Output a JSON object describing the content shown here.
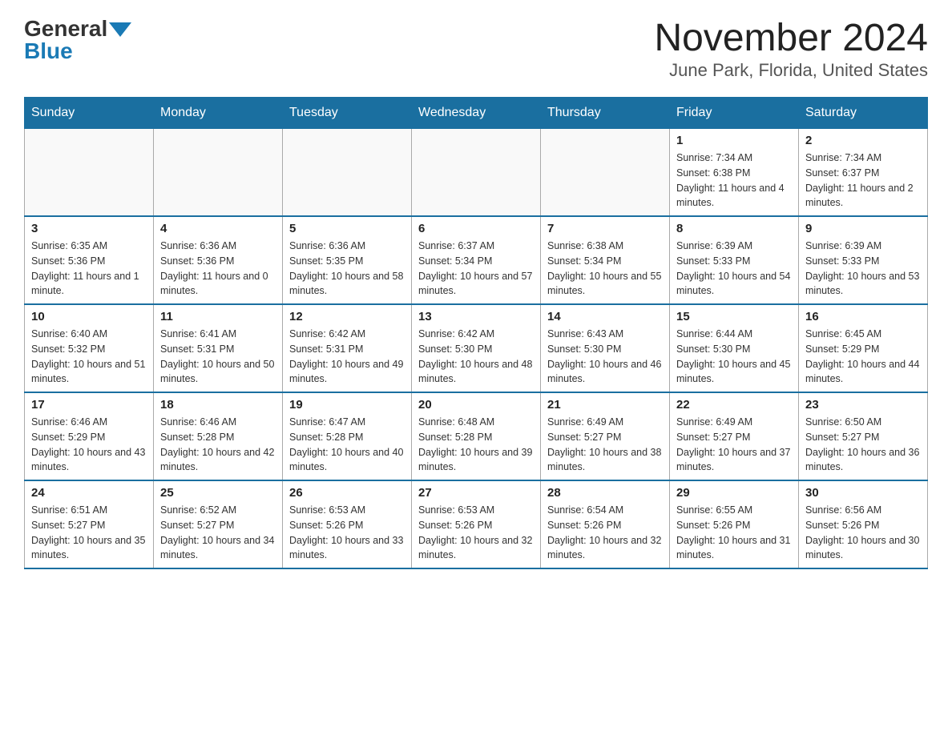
{
  "logo": {
    "general": "General",
    "blue": "Blue"
  },
  "title": "November 2024",
  "subtitle": "June Park, Florida, United States",
  "headers": [
    "Sunday",
    "Monday",
    "Tuesday",
    "Wednesday",
    "Thursday",
    "Friday",
    "Saturday"
  ],
  "weeks": [
    [
      {
        "day": "",
        "info": ""
      },
      {
        "day": "",
        "info": ""
      },
      {
        "day": "",
        "info": ""
      },
      {
        "day": "",
        "info": ""
      },
      {
        "day": "",
        "info": ""
      },
      {
        "day": "1",
        "info": "Sunrise: 7:34 AM\nSunset: 6:38 PM\nDaylight: 11 hours and 4 minutes."
      },
      {
        "day": "2",
        "info": "Sunrise: 7:34 AM\nSunset: 6:37 PM\nDaylight: 11 hours and 2 minutes."
      }
    ],
    [
      {
        "day": "3",
        "info": "Sunrise: 6:35 AM\nSunset: 5:36 PM\nDaylight: 11 hours and 1 minute."
      },
      {
        "day": "4",
        "info": "Sunrise: 6:36 AM\nSunset: 5:36 PM\nDaylight: 11 hours and 0 minutes."
      },
      {
        "day": "5",
        "info": "Sunrise: 6:36 AM\nSunset: 5:35 PM\nDaylight: 10 hours and 58 minutes."
      },
      {
        "day": "6",
        "info": "Sunrise: 6:37 AM\nSunset: 5:34 PM\nDaylight: 10 hours and 57 minutes."
      },
      {
        "day": "7",
        "info": "Sunrise: 6:38 AM\nSunset: 5:34 PM\nDaylight: 10 hours and 55 minutes."
      },
      {
        "day": "8",
        "info": "Sunrise: 6:39 AM\nSunset: 5:33 PM\nDaylight: 10 hours and 54 minutes."
      },
      {
        "day": "9",
        "info": "Sunrise: 6:39 AM\nSunset: 5:33 PM\nDaylight: 10 hours and 53 minutes."
      }
    ],
    [
      {
        "day": "10",
        "info": "Sunrise: 6:40 AM\nSunset: 5:32 PM\nDaylight: 10 hours and 51 minutes."
      },
      {
        "day": "11",
        "info": "Sunrise: 6:41 AM\nSunset: 5:31 PM\nDaylight: 10 hours and 50 minutes."
      },
      {
        "day": "12",
        "info": "Sunrise: 6:42 AM\nSunset: 5:31 PM\nDaylight: 10 hours and 49 minutes."
      },
      {
        "day": "13",
        "info": "Sunrise: 6:42 AM\nSunset: 5:30 PM\nDaylight: 10 hours and 48 minutes."
      },
      {
        "day": "14",
        "info": "Sunrise: 6:43 AM\nSunset: 5:30 PM\nDaylight: 10 hours and 46 minutes."
      },
      {
        "day": "15",
        "info": "Sunrise: 6:44 AM\nSunset: 5:30 PM\nDaylight: 10 hours and 45 minutes."
      },
      {
        "day": "16",
        "info": "Sunrise: 6:45 AM\nSunset: 5:29 PM\nDaylight: 10 hours and 44 minutes."
      }
    ],
    [
      {
        "day": "17",
        "info": "Sunrise: 6:46 AM\nSunset: 5:29 PM\nDaylight: 10 hours and 43 minutes."
      },
      {
        "day": "18",
        "info": "Sunrise: 6:46 AM\nSunset: 5:28 PM\nDaylight: 10 hours and 42 minutes."
      },
      {
        "day": "19",
        "info": "Sunrise: 6:47 AM\nSunset: 5:28 PM\nDaylight: 10 hours and 40 minutes."
      },
      {
        "day": "20",
        "info": "Sunrise: 6:48 AM\nSunset: 5:28 PM\nDaylight: 10 hours and 39 minutes."
      },
      {
        "day": "21",
        "info": "Sunrise: 6:49 AM\nSunset: 5:27 PM\nDaylight: 10 hours and 38 minutes."
      },
      {
        "day": "22",
        "info": "Sunrise: 6:49 AM\nSunset: 5:27 PM\nDaylight: 10 hours and 37 minutes."
      },
      {
        "day": "23",
        "info": "Sunrise: 6:50 AM\nSunset: 5:27 PM\nDaylight: 10 hours and 36 minutes."
      }
    ],
    [
      {
        "day": "24",
        "info": "Sunrise: 6:51 AM\nSunset: 5:27 PM\nDaylight: 10 hours and 35 minutes."
      },
      {
        "day": "25",
        "info": "Sunrise: 6:52 AM\nSunset: 5:27 PM\nDaylight: 10 hours and 34 minutes."
      },
      {
        "day": "26",
        "info": "Sunrise: 6:53 AM\nSunset: 5:26 PM\nDaylight: 10 hours and 33 minutes."
      },
      {
        "day": "27",
        "info": "Sunrise: 6:53 AM\nSunset: 5:26 PM\nDaylight: 10 hours and 32 minutes."
      },
      {
        "day": "28",
        "info": "Sunrise: 6:54 AM\nSunset: 5:26 PM\nDaylight: 10 hours and 32 minutes."
      },
      {
        "day": "29",
        "info": "Sunrise: 6:55 AM\nSunset: 5:26 PM\nDaylight: 10 hours and 31 minutes."
      },
      {
        "day": "30",
        "info": "Sunrise: 6:56 AM\nSunset: 5:26 PM\nDaylight: 10 hours and 30 minutes."
      }
    ]
  ]
}
